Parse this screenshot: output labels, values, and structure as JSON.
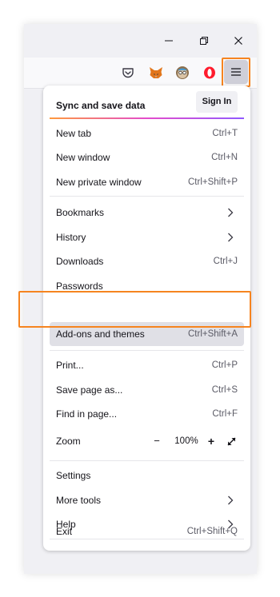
{
  "menu": {
    "sync": {
      "heading": "Sync and save data",
      "signin_label": "Sign In"
    },
    "items": {
      "new_tab": {
        "label": "New tab",
        "shortcut": "Ctrl+T"
      },
      "new_window": {
        "label": "New window",
        "shortcut": "Ctrl+N"
      },
      "new_private": {
        "label": "New private window",
        "shortcut": "Ctrl+Shift+P"
      },
      "bookmarks": {
        "label": "Bookmarks"
      },
      "history": {
        "label": "History"
      },
      "downloads": {
        "label": "Downloads",
        "shortcut": "Ctrl+J"
      },
      "passwords": {
        "label": "Passwords"
      },
      "addons": {
        "label": "Add-ons and themes",
        "shortcut": "Ctrl+Shift+A"
      },
      "print": {
        "label": "Print...",
        "shortcut": "Ctrl+P"
      },
      "save_page": {
        "label": "Save page as...",
        "shortcut": "Ctrl+S"
      },
      "find": {
        "label": "Find in page...",
        "shortcut": "Ctrl+F"
      },
      "zoom": {
        "label": "Zoom",
        "minus": "−",
        "level": "100%",
        "plus": "+"
      },
      "settings": {
        "label": "Settings"
      },
      "more_tools": {
        "label": "More tools"
      },
      "help": {
        "label": "Help"
      },
      "exit": {
        "label": "Exit",
        "shortcut": "Ctrl+Shift+Q"
      }
    }
  },
  "toolbar_icons": [
    "pocket-icon",
    "metamask-fox-icon",
    "avatar-extension-icon",
    "opera-red-o-icon",
    "hamburger-menu-icon"
  ],
  "colors": {
    "highlight": "#f6841f",
    "active_bg": "#e0e0e6",
    "opera_red": "#ff1b2d"
  }
}
